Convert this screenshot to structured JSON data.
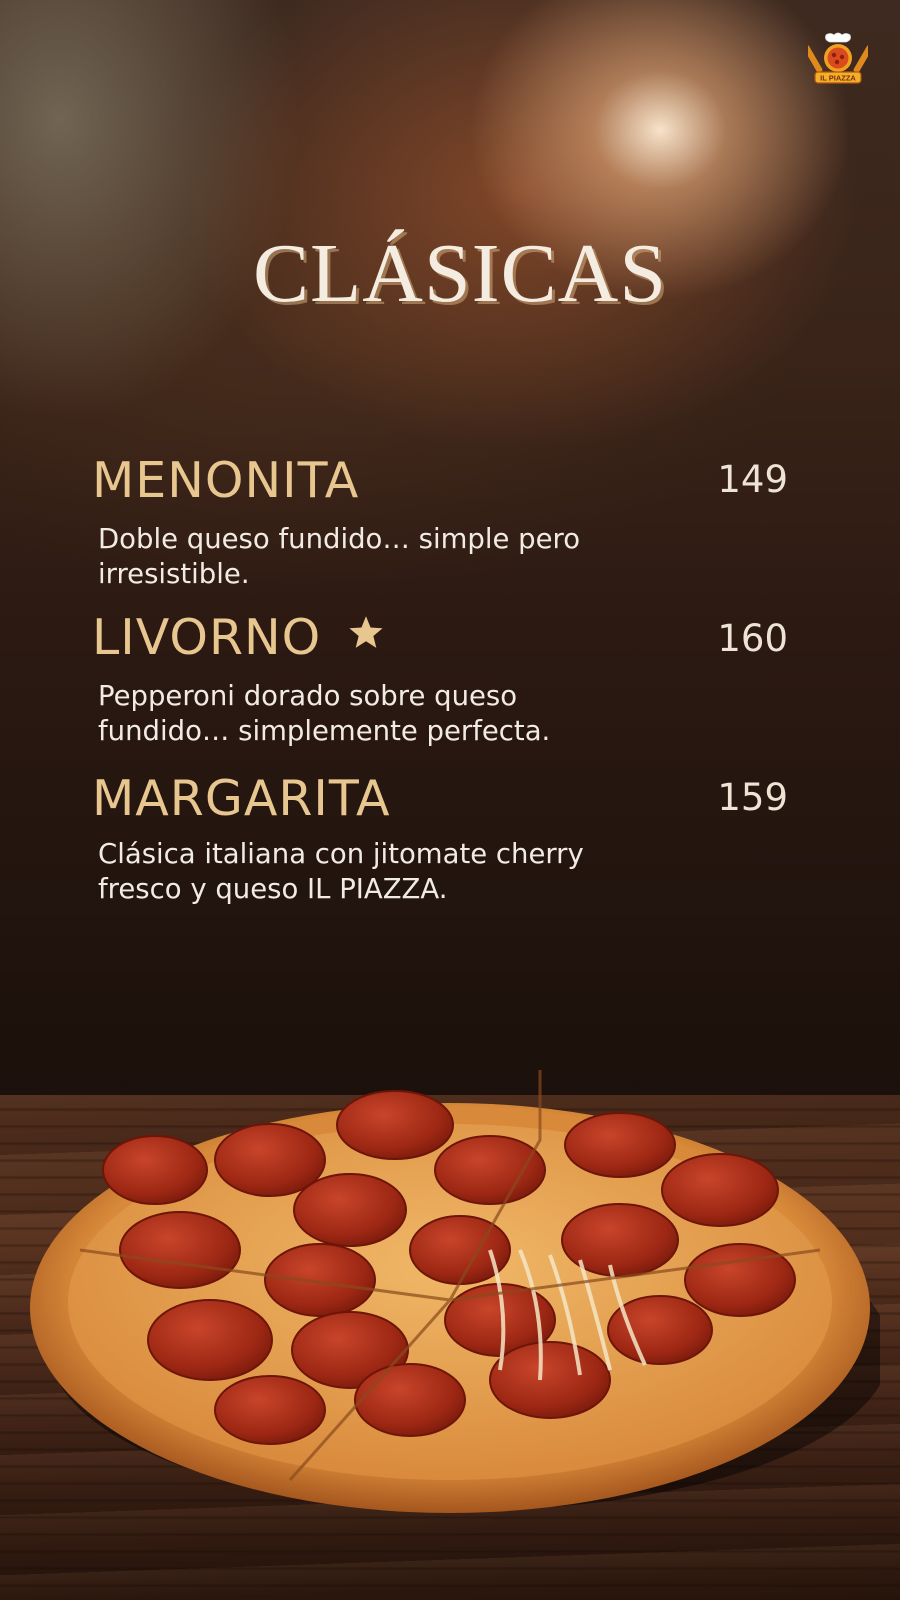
{
  "logo": {
    "text": "IL PIAZZA"
  },
  "title": "CLÁSICAS",
  "items": [
    {
      "name": "MENONITA",
      "price": "149",
      "description_line1": "Doble queso fundido… simple pero",
      "description_line2": "irresistible.",
      "featured": false
    },
    {
      "name": "LIVORNO",
      "price": "160",
      "description_line1": "Pepperoni dorado sobre queso",
      "description_line2": "fundido… simplemente perfecta.",
      "featured": true,
      "badge_icon": "star-icon"
    },
    {
      "name": "MARGARITA",
      "price": "159",
      "description_line1": "Clásica italiana con jitomate cherry",
      "description_line2": "fresco y queso IL PIAZZA.",
      "featured": false
    }
  ],
  "colors": {
    "accent": "#e8c690",
    "text": "#f1ebe3",
    "background": "#1d110c"
  }
}
